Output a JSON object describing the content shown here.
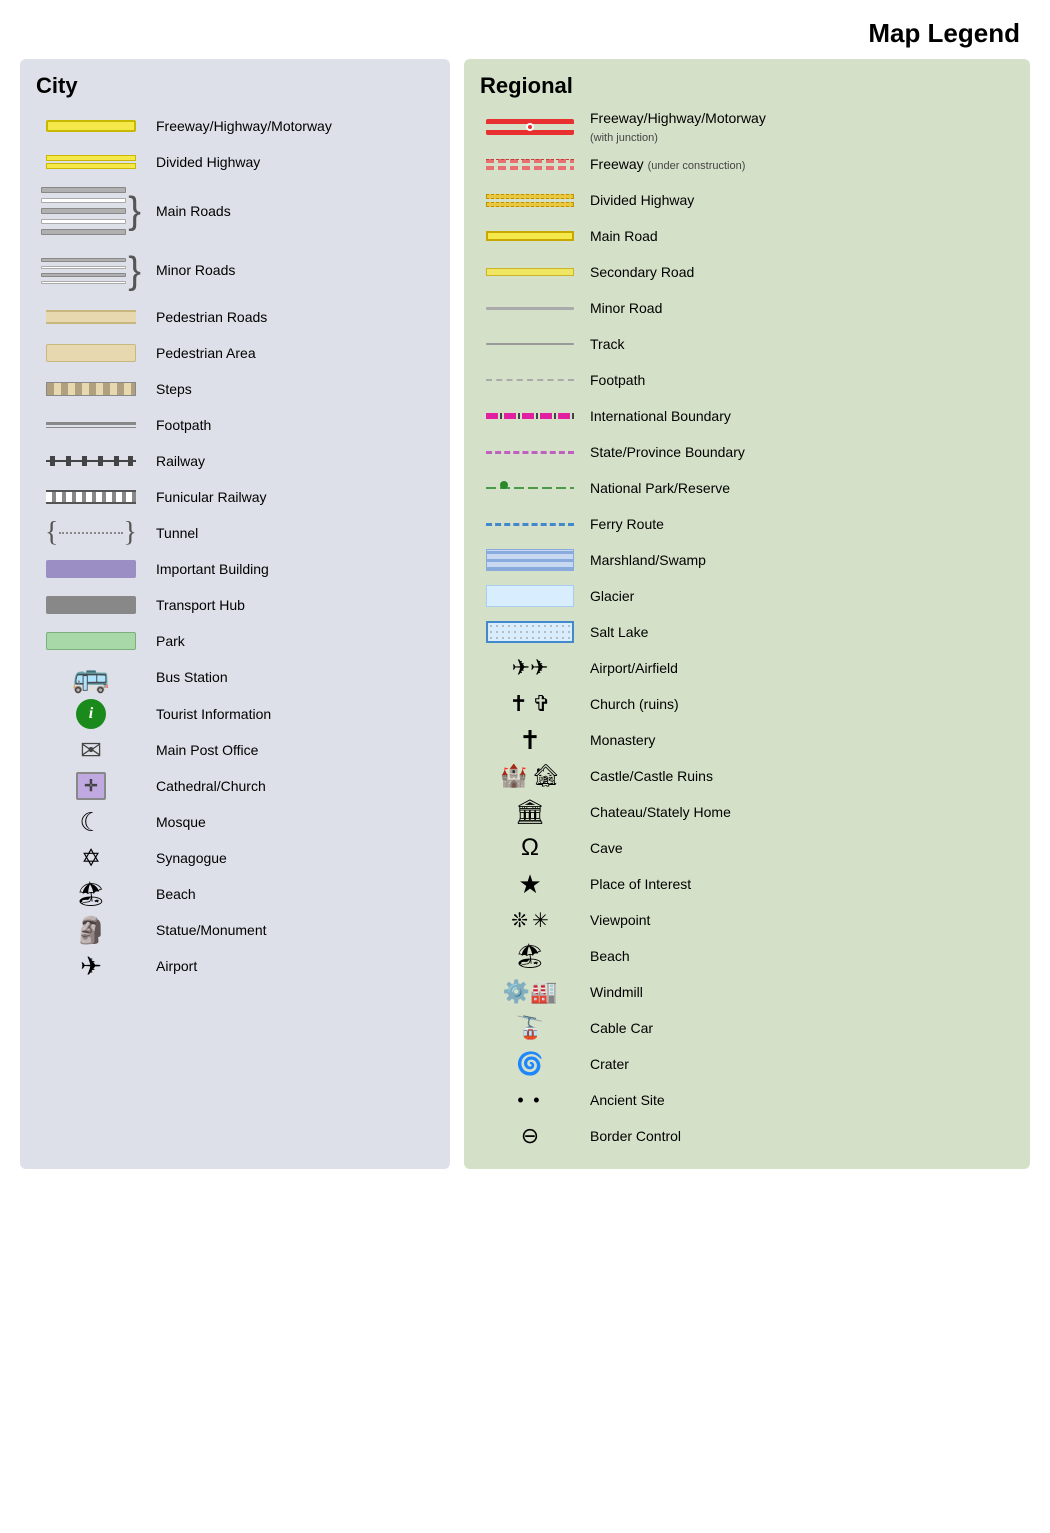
{
  "title": "Map Legend",
  "city": {
    "heading": "City",
    "items": [
      {
        "id": "freeway-highway",
        "label": "Freeway/Highway/Motorway",
        "icon": "freeway-city"
      },
      {
        "id": "divided-highway",
        "label": "Divided Highway",
        "icon": "divided-highway-city"
      },
      {
        "id": "main-roads",
        "label": "Main Roads",
        "icon": "main-roads-brace"
      },
      {
        "id": "minor-roads",
        "label": "Minor Roads",
        "icon": "minor-roads-brace"
      },
      {
        "id": "pedestrian-roads",
        "label": "Pedestrian Roads",
        "icon": "ped-road"
      },
      {
        "id": "pedestrian-area",
        "label": "Pedestrian Area",
        "icon": "ped-area"
      },
      {
        "id": "steps",
        "label": "Steps",
        "icon": "steps"
      },
      {
        "id": "footpath",
        "label": "Footpath",
        "icon": "footpath"
      },
      {
        "id": "railway",
        "label": "Railway",
        "icon": "railway"
      },
      {
        "id": "funicular",
        "label": "Funicular Railway",
        "icon": "funicular"
      },
      {
        "id": "tunnel",
        "label": "Tunnel",
        "icon": "tunnel"
      },
      {
        "id": "important-building",
        "label": "Important Building",
        "icon": "imp-building"
      },
      {
        "id": "transport-hub",
        "label": "Transport Hub",
        "icon": "transport-hub"
      },
      {
        "id": "park",
        "label": "Park",
        "icon": "park"
      },
      {
        "id": "bus-station",
        "label": "Bus Station",
        "icon": "bus"
      },
      {
        "id": "tourist-info",
        "label": "Tourist Information",
        "icon": "tourist-info"
      },
      {
        "id": "main-post",
        "label": "Main Post Office",
        "icon": "mail"
      },
      {
        "id": "cathedral",
        "label": "Cathedral/Church",
        "icon": "cathedral"
      },
      {
        "id": "mosque",
        "label": "Mosque",
        "icon": "mosque"
      },
      {
        "id": "synagogue",
        "label": "Synagogue",
        "icon": "synagogue"
      },
      {
        "id": "beach-city",
        "label": "Beach",
        "icon": "beach-city"
      },
      {
        "id": "statue",
        "label": "Statue/Monument",
        "icon": "statue"
      },
      {
        "id": "airport-city",
        "label": "Airport",
        "icon": "airport-city"
      }
    ]
  },
  "regional": {
    "heading": "Regional",
    "items": [
      {
        "id": "reg-freeway",
        "label": "Freeway/Highway/Motorway",
        "sublabel": "(with junction)",
        "icon": "reg-freeway"
      },
      {
        "id": "reg-freeway-uc",
        "label": "Freeway",
        "sublabel": "(under construction)",
        "icon": "reg-freeway-uc"
      },
      {
        "id": "reg-div-highway",
        "label": "Divided Highway",
        "icon": "reg-divhw"
      },
      {
        "id": "reg-mainroad",
        "label": "Main Road",
        "icon": "reg-mainroad"
      },
      {
        "id": "reg-secondary",
        "label": "Secondary Road",
        "icon": "reg-secondary"
      },
      {
        "id": "reg-minor",
        "label": "Minor Road",
        "icon": "reg-minor"
      },
      {
        "id": "reg-track",
        "label": "Track",
        "icon": "reg-track"
      },
      {
        "id": "reg-footpath",
        "label": "Footpath",
        "icon": "reg-footpath"
      },
      {
        "id": "reg-intl-boundary",
        "label": "International Boundary",
        "icon": "reg-intl-boundary"
      },
      {
        "id": "reg-state-boundary",
        "label": "State/Province Boundary",
        "icon": "reg-state-boundary"
      },
      {
        "id": "reg-natpark",
        "label": "National Park/Reserve",
        "icon": "reg-natpark"
      },
      {
        "id": "reg-ferry",
        "label": "Ferry Route",
        "icon": "reg-ferry"
      },
      {
        "id": "reg-marsh",
        "label": "Marshland/Swamp",
        "icon": "reg-marsh"
      },
      {
        "id": "reg-glacier",
        "label": "Glacier",
        "icon": "reg-glacier"
      },
      {
        "id": "reg-saltlake",
        "label": "Salt Lake",
        "icon": "reg-saltlake"
      },
      {
        "id": "reg-airport",
        "label": "Airport/Airfield",
        "icon": "reg-airport"
      },
      {
        "id": "reg-church",
        "label": "Church (ruins)",
        "icon": "reg-church"
      },
      {
        "id": "reg-monastery",
        "label": "Monastery",
        "icon": "reg-monastery"
      },
      {
        "id": "reg-castle",
        "label": "Castle/Castle Ruins",
        "icon": "reg-castle"
      },
      {
        "id": "reg-chateau",
        "label": "Chateau/Stately Home",
        "icon": "reg-chateau"
      },
      {
        "id": "reg-cave",
        "label": "Cave",
        "icon": "reg-cave"
      },
      {
        "id": "reg-poi",
        "label": "Place of Interest",
        "icon": "reg-poi"
      },
      {
        "id": "reg-viewpoint",
        "label": "Viewpoint",
        "icon": "reg-viewpoint"
      },
      {
        "id": "reg-beach",
        "label": "Beach",
        "icon": "reg-beach"
      },
      {
        "id": "reg-windmill",
        "label": "Windmill",
        "icon": "reg-windmill"
      },
      {
        "id": "reg-cablecar",
        "label": "Cable Car",
        "icon": "reg-cablecar"
      },
      {
        "id": "reg-crater",
        "label": "Crater",
        "icon": "reg-crater"
      },
      {
        "id": "reg-ancient",
        "label": "Ancient Site",
        "icon": "reg-ancient"
      },
      {
        "id": "reg-border",
        "label": "Border Control",
        "icon": "reg-border"
      }
    ]
  }
}
